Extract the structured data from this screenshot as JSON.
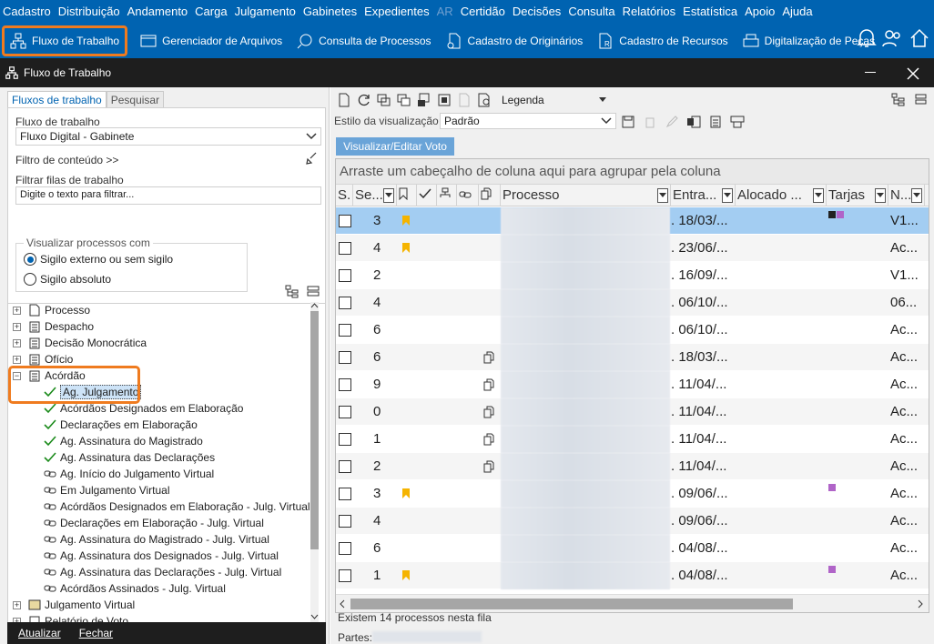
{
  "menu": [
    "Cadastro",
    "Distribuição",
    "Andamento",
    "Carga",
    "Julgamento",
    "Gabinetes",
    "Expedientes",
    "AR",
    "Certidão",
    "Decisões",
    "Consulta",
    "Relatórios",
    "Estatística",
    "Apoio",
    "Ajuda"
  ],
  "toolbar": {
    "fluxo": "Fluxo de Trabalho",
    "arquivos": "Gerenciador de Arquivos",
    "consulta": "Consulta de Processos",
    "originarios": "Cadastro de Originários",
    "recursos": "Cadastro de Recursos",
    "pecas": "Digitalização de Peças"
  },
  "window": {
    "title": "Fluxo de Trabalho"
  },
  "left": {
    "tab_fluxos": "Fluxos de trabalho",
    "tab_pesquisar": "Pesquisar",
    "fluxo_label": "Fluxo de trabalho",
    "fluxo_value": "Fluxo Digital - Gabinete",
    "filtro_conteudo": "Filtro de conteúdo >>",
    "filtrar_label": "Filtrar filas de trabalho",
    "filtrar_placeholder": "Digite o texto para filtrar...",
    "visualizar_label": "Visualizar processos com",
    "radio1": "Sigilo externo ou sem sigilo",
    "radio2": "Sigilo absoluto",
    "tree": {
      "processo": "Processo",
      "despacho": "Despacho",
      "decisao": "Decisão Monocrática",
      "oficio": "Ofício",
      "acordao": "Acórdão",
      "acordao_children": [
        "Ag. Julgamento",
        "Acórdãos Designados em Elaboração",
        "Declarações em Elaboração",
        "Ag. Assinatura do Magistrado",
        "Ag. Assinatura das Declarações",
        "Ag. Início do Julgamento Virtual",
        "Em Julgamento Virtual",
        "Acórdãos Designados em Elaboração - Julg. Virtual",
        "Declarações em Elaboração - Julg. Virtual",
        "Ag. Assinatura do Magistrado - Julg. Virtual",
        "Ag. Assinatura dos Designados - Julg. Virtual",
        "Ag. Assinatura das Declarações - Julg. Virtual",
        "Acórdãos Assinados - Julg. Virtual"
      ],
      "julgamento": "Julgamento Virtual",
      "relatorio": "Relatório de Voto"
    },
    "atualizar": "Atualizar",
    "fechar": "Fechar"
  },
  "right": {
    "legenda": "Legenda",
    "estilo_label": "Estilo da visualização",
    "estilo_value": "Padrão",
    "visualizar_btn": "Visualizar/Editar Voto",
    "group_hint": "Arraste um cabeçalho de coluna aqui para agrupar pela coluna",
    "columns": [
      "S.",
      "Se...",
      "Processo",
      "Entra...",
      "Alocado ...",
      "Tarjas",
      "N..."
    ],
    "rows": [
      {
        "seq": "3",
        "entra": ". 18/03/...",
        "n": "V1..."
      },
      {
        "seq": "4",
        "entra": ". 23/06/...",
        "n": "Ac..."
      },
      {
        "seq": "2",
        "entra": ". 16/09/...",
        "n": "V1..."
      },
      {
        "seq": "4",
        "entra": ". 06/10/...",
        "n": "06..."
      },
      {
        "seq": "6",
        "entra": ". 06/10/...",
        "n": "Ac..."
      },
      {
        "seq": "6",
        "entra": ". 18/03/...",
        "n": "Ac..."
      },
      {
        "seq": "9",
        "entra": ". 11/04/...",
        "n": "Ac..."
      },
      {
        "seq": "0",
        "entra": ". 11/04/...",
        "n": "Ac..."
      },
      {
        "seq": "1",
        "entra": ". 11/04/...",
        "n": "Ac..."
      },
      {
        "seq": "2",
        "entra": ". 11/04/...",
        "n": "Ac..."
      },
      {
        "seq": "3",
        "entra": ". 09/06/...",
        "n": "Ac..."
      },
      {
        "seq": "4",
        "entra": ". 09/06/...",
        "n": "Ac..."
      },
      {
        "seq": "6",
        "entra": ". 04/08/...",
        "n": "Ac..."
      },
      {
        "seq": "1",
        "entra": ". 04/08/...",
        "n": "Ac..."
      }
    ],
    "status": "Existem 14 processos nesta fila",
    "partes": "Partes:"
  },
  "colors": {
    "brand": "#0063b1",
    "highlight": "#ef7b1f",
    "selected_row": "#a3cdf2",
    "bookmark": "#f5b400",
    "tarja_purple": "#b064c8"
  }
}
